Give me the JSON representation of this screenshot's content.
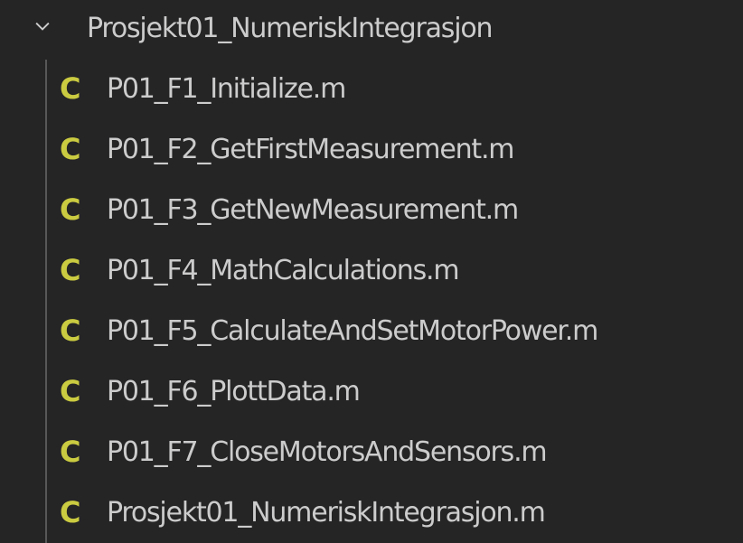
{
  "explorer": {
    "folder": {
      "name": "Prosjekt01_NumeriskIntegrasjon",
      "expanded": true,
      "chevron_icon": "chevron-down-icon"
    },
    "icon_color": "#cbcb41",
    "file_icon_glyph": "C",
    "files": [
      {
        "name": "P01_F1_Initialize.m"
      },
      {
        "name": "P01_F2_GetFirstMeasurement.m"
      },
      {
        "name": "P01_F3_GetNewMeasurement.m"
      },
      {
        "name": "P01_F4_MathCalculations.m"
      },
      {
        "name": "P01_F5_CalculateAndSetMotorPower.m"
      },
      {
        "name": "P01_F6_PlottData.m"
      },
      {
        "name": "P01_F7_CloseMotorsAndSensors.m"
      },
      {
        "name": "Prosjekt01_NumeriskIntegrasjon.m"
      }
    ]
  }
}
